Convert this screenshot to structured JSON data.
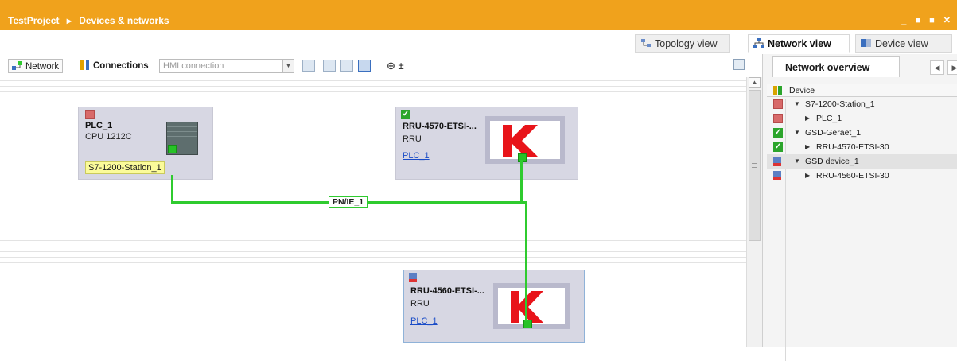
{
  "titlebar": {
    "project": "TestProject",
    "separator": "▸",
    "section": "Devices & networks",
    "controls": "_ ■ ■ ✕"
  },
  "view_tabs": {
    "topology": "Topology view",
    "network": "Network view",
    "device": "Device view"
  },
  "toolbar": {
    "network_btn": "Network",
    "connections_btn": "Connections",
    "hmi_select": "HMI connection",
    "zoom": "⊕ ±"
  },
  "devices": {
    "plc": {
      "name": "PLC_1",
      "sub": "CPU 1212C",
      "station": "S7-1200-Station_1"
    },
    "rru4570": {
      "name": "RRU-4570-ETSI-...",
      "sub": "RRU",
      "link": "PLC_1"
    },
    "rru4560": {
      "name": "RRU-4560-ETSI-...",
      "sub": "RRU",
      "link": "PLC_1"
    }
  },
  "network": {
    "label": "PN/IE_1",
    "color": "#2fcb2f"
  },
  "overview": {
    "tab": "Network overview",
    "header": "Device",
    "rows": [
      {
        "label": "S7-1200-Station_1",
        "level": 0,
        "icon": "error-icon"
      },
      {
        "label": "PLC_1",
        "level": 1,
        "icon": "error-icon"
      },
      {
        "label": "GSD-Geraet_1",
        "level": 0,
        "icon": "ok-icon"
      },
      {
        "label": "RRU-4570-ETSI-30",
        "level": 1,
        "icon": "ok-icon"
      },
      {
        "label": "GSD device_1",
        "level": 0,
        "icon": "gsd-icon"
      },
      {
        "label": "RRU-4560-ETSI-30",
        "level": 1,
        "icon": "gsd-icon"
      }
    ]
  },
  "colors": {
    "titlebar": "#f0a21c",
    "device_bg": "#d7d7e3",
    "link": "#1a4cc7",
    "brand_k": "#e8141a"
  }
}
